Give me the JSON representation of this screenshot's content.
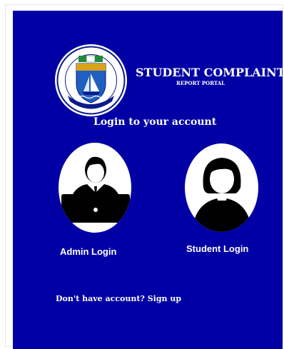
{
  "app": {
    "title": "STUDENT COMPLAINT",
    "subtitle": "REPORT PORTAL",
    "logo": {
      "motto": "FOR SELF-RELIANCE AND DEVELOPMENT",
      "icon": "university-crest-icon"
    }
  },
  "login": {
    "heading": "Login to your account",
    "options": [
      {
        "label": "Admin Login",
        "icon": "admin-avatar-icon"
      },
      {
        "label": "Student Login",
        "icon": "student-avatar-icon"
      }
    ]
  },
  "signup": {
    "prompt": "Don't have account?",
    "link_label": "Sign up"
  },
  "colors": {
    "background": "#0000a4",
    "text": "#ffffff",
    "avatar_fill": "#000000"
  }
}
